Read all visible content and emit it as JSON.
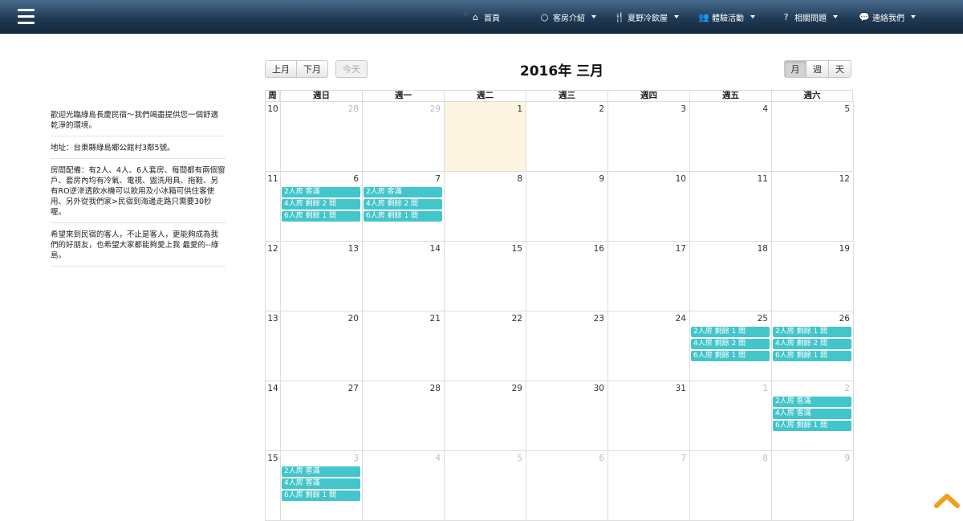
{
  "nav": {
    "items": [
      {
        "icon": "home-icon",
        "glyph": "⌂",
        "label": "首頁",
        "caret": false
      },
      {
        "icon": "circle-icon",
        "glyph": "○",
        "label": "客房介紹",
        "caret": true
      },
      {
        "icon": "utensils-icon",
        "glyph": "🍴",
        "label": "夏野冷飲屋",
        "caret": true
      },
      {
        "icon": "users-icon",
        "glyph": "👥",
        "label": "體驗活動",
        "caret": true
      },
      {
        "icon": "question-icon",
        "glyph": "?",
        "label": "相關問題",
        "caret": true
      },
      {
        "icon": "comments-icon",
        "glyph": "💬",
        "label": "連絡我們",
        "caret": true
      }
    ]
  },
  "sidebar": {
    "blocks": [
      "歡迎光臨綠島長慶民宿～我們竭盡提供您一個舒適乾淨的環境。",
      "地址：台東縣綠島鄉公館村3鄰5號。",
      "房間配備：有2人、4人、6人套房、每間都有兩個窗戶、套房內均有冷氣、電視、盥洗用具、拖鞋、另有RO逆滲透飲水機可以飲用及小冰箱可供住客使用、另外從我們家>民宿到海邊走路只需要30秒喔。",
      "希望來到民宿的客人，不止是客人，更能夠成為我們的好朋友，也希望大家都能夠愛上我 最愛的--綠島。"
    ]
  },
  "calendar": {
    "prev_label": "上月",
    "next_label": "下月",
    "today_label": "今天",
    "title": "2016年 三月",
    "view_month": "月",
    "view_week": "週",
    "view_day": "天",
    "week_header": "周",
    "day_headers": [
      "週日",
      "週一",
      "週二",
      "週三",
      "週四",
      "週五",
      "週六"
    ],
    "weeks": [
      {
        "num": "10",
        "days": [
          {
            "d": "28",
            "other": true,
            "events": []
          },
          {
            "d": "29",
            "other": true,
            "events": []
          },
          {
            "d": "1",
            "today": true,
            "events": []
          },
          {
            "d": "2",
            "events": []
          },
          {
            "d": "3",
            "events": []
          },
          {
            "d": "4",
            "events": []
          },
          {
            "d": "5",
            "events": []
          }
        ]
      },
      {
        "num": "11",
        "days": [
          {
            "d": "6",
            "events": [
              "2人房 客滿",
              "4人房 剩餘 2 間",
              "6人房 剩餘 1 間"
            ]
          },
          {
            "d": "7",
            "events": [
              "2人房 客滿",
              "4人房 剩餘 2 間",
              "6人房 剩餘 1 間"
            ]
          },
          {
            "d": "8",
            "events": []
          },
          {
            "d": "9",
            "events": []
          },
          {
            "d": "10",
            "events": []
          },
          {
            "d": "11",
            "events": []
          },
          {
            "d": "12",
            "events": []
          }
        ]
      },
      {
        "num": "12",
        "days": [
          {
            "d": "13",
            "events": []
          },
          {
            "d": "14",
            "events": []
          },
          {
            "d": "15",
            "events": []
          },
          {
            "d": "16",
            "events": []
          },
          {
            "d": "17",
            "events": []
          },
          {
            "d": "18",
            "events": []
          },
          {
            "d": "19",
            "events": []
          }
        ]
      },
      {
        "num": "13",
        "days": [
          {
            "d": "20",
            "events": []
          },
          {
            "d": "21",
            "events": []
          },
          {
            "d": "22",
            "events": []
          },
          {
            "d": "23",
            "events": []
          },
          {
            "d": "24",
            "events": []
          },
          {
            "d": "25",
            "events": [
              "2人房 剩餘 1 間",
              "4人房 剩餘 2 間",
              "6人房 剩餘 1 間"
            ]
          },
          {
            "d": "26",
            "events": [
              "2人房 剩餘 1 間",
              "4人房 剩餘 2 間",
              "6人房 剩餘 1 間"
            ]
          }
        ]
      },
      {
        "num": "14",
        "days": [
          {
            "d": "27",
            "events": []
          },
          {
            "d": "28",
            "events": []
          },
          {
            "d": "29",
            "events": []
          },
          {
            "d": "30",
            "events": []
          },
          {
            "d": "31",
            "events": []
          },
          {
            "d": "1",
            "other": true,
            "events": []
          },
          {
            "d": "2",
            "other": true,
            "events": [
              "2人房 客滿",
              "4人房 客滿",
              "6人房 剩餘 1 間"
            ]
          }
        ]
      },
      {
        "num": "15",
        "days": [
          {
            "d": "3",
            "other": true,
            "events": [
              "2人房 客滿",
              "4人房 客滿",
              "6人房 剩餘 1 間"
            ]
          },
          {
            "d": "4",
            "other": true,
            "events": []
          },
          {
            "d": "5",
            "other": true,
            "events": []
          },
          {
            "d": "6",
            "other": true,
            "events": []
          },
          {
            "d": "7",
            "other": true,
            "events": []
          },
          {
            "d": "8",
            "other": true,
            "events": []
          },
          {
            "d": "9",
            "other": true,
            "events": []
          }
        ]
      }
    ]
  },
  "colors": {
    "event": "#42c5cb",
    "today": "#fcf4e0",
    "accent": "#f0a020",
    "navbar": "#1f3a56"
  }
}
